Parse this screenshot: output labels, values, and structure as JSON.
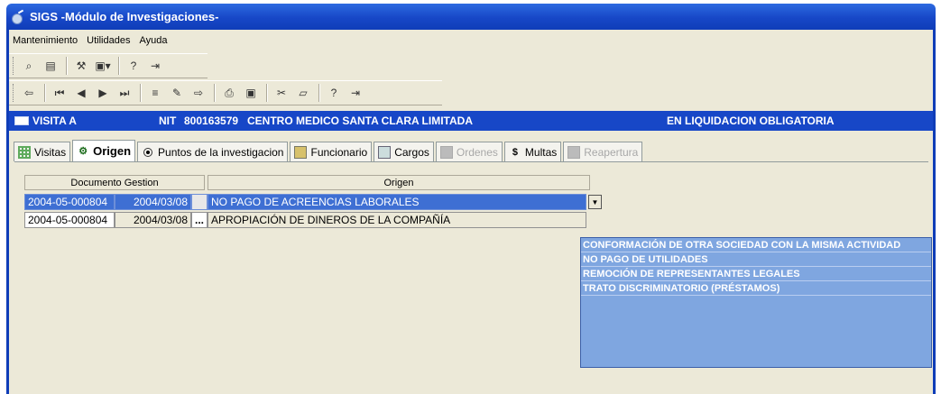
{
  "window": {
    "title": "SIGS -Módulo de Investigaciones-"
  },
  "menu": [
    "Mantenimiento",
    "Utilidades",
    "Ayuda"
  ],
  "visita": {
    "label": "VISITA A",
    "nit_label": "NIT",
    "nit": "800163579",
    "company": "CENTRO MEDICO SANTA CLARA LIMITADA",
    "status": "EN LIQUIDACION OBLIGATORIA"
  },
  "tabs": [
    {
      "label": "Visitas",
      "icon": "grid-icon",
      "state": "normal"
    },
    {
      "label": "Origen",
      "icon": "gear-icon",
      "state": "active"
    },
    {
      "label": "Puntos de la investigacion",
      "icon": "radio-icon",
      "state": "normal"
    },
    {
      "label": "Funcionario",
      "icon": "folder-icon",
      "state": "normal"
    },
    {
      "label": "Cargos",
      "icon": "disk-icon",
      "state": "normal"
    },
    {
      "label": "Ordenes",
      "icon": "document-icon",
      "state": "disabled"
    },
    {
      "label": "Multas",
      "icon": "dollar-icon",
      "state": "normal"
    },
    {
      "label": "Reapertura",
      "icon": "box-icon",
      "state": "disabled"
    }
  ],
  "table": {
    "headers": [
      "Documento Gestion",
      "Origen"
    ],
    "rows": [
      {
        "doc": "2004-05-000804",
        "date": "2004/03/08",
        "btn": "",
        "origen": "NO PAGO DE ACREENCIAS LABORALES"
      },
      {
        "doc": "2004-05-000804",
        "date": "2004/03/08",
        "btn": "...",
        "origen": "APROPIACIÓN DE DINEROS DE LA COMPAÑÍA"
      }
    ]
  },
  "dropdown": {
    "options": [
      "CONFORMACIÓN DE OTRA SOCIEDAD CON LA MISMA ACTIVIDAD",
      "NO PAGO DE UTILIDADES",
      "REMOCIÓN DE REPRESENTANTES LEGALES",
      "TRATO DISCRIMINATORIO  (PRÉSTAMOS)"
    ]
  },
  "colors": {
    "titlebar": "#1747c7",
    "dropdown_bg": "#7fa6e0",
    "selected_row": "#3e6fd3"
  }
}
